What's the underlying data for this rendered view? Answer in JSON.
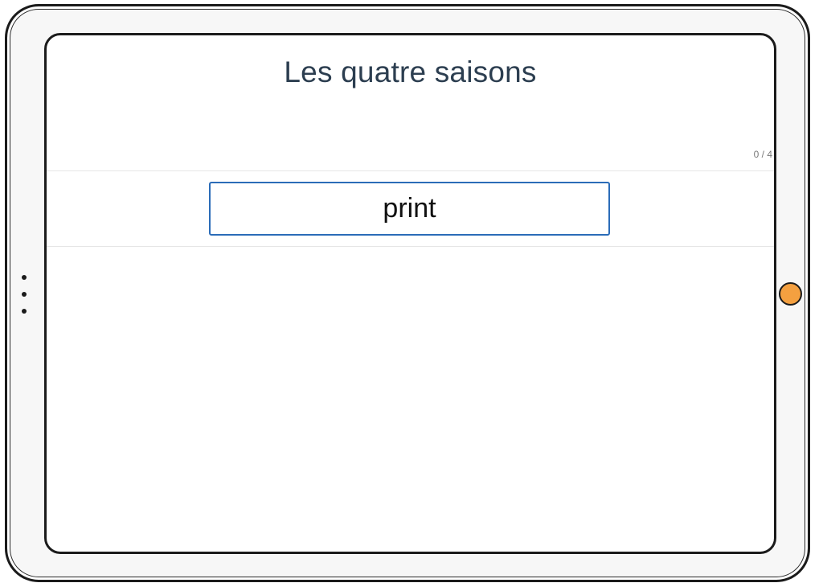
{
  "app": {
    "title": "Les quatre saisons",
    "progress_counter": "0 / 4"
  },
  "answer_input": {
    "value": "print",
    "placeholder": ""
  },
  "device": {
    "home_button_color": "#f4a040",
    "input_border_color": "#2b6cb8",
    "title_color": "#2c3e50"
  }
}
